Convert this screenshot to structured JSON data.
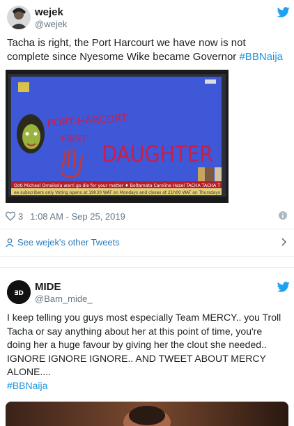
{
  "tweet1": {
    "display_name": "wejek",
    "handle": "@wejek",
    "text": "Tacha is right, the Port Harcourt we have now is not complete since Nyesome Wike became Governor ",
    "hashtag": "#BBNaija",
    "media": {
      "tv_title_line1": "PORT-HARCORT",
      "tv_title_line2": "FIRST",
      "tv_title_line3": "DAUGHTER",
      "ticker_line1": "Ooti Michael Omaikola warri go die for your matter  ♦ Boltamata Caroline Hazel TACHA TACHA T",
      "ticker_line2": "ee subscribers only  Voting opens at 19h30 WAT on Mondays and closes at 21h00 WAT on Thursdays"
    },
    "like_count": "3",
    "timestamp": "1:08 AM - Sep 25, 2019",
    "see_more_label": "See wejek's other Tweets"
  },
  "tweet2": {
    "display_name": "MIDE",
    "handle": "@Bam_mide_",
    "text": "I keep telling you guys most especially Team MERCY.. you Troll Tacha or say anything about her at this point of time, you're doing her a huge favour by giving her the clout she needed.. IGNORE IGNORE IGNORE.. AND TWEET ABOUT MERCY ALONE....",
    "hashtag": "#BBNaija"
  },
  "colors": {
    "twitter_blue": "#1da1f2",
    "link_blue": "#1b95e0",
    "muted_gray": "#657786",
    "divider": "#e6ecf0"
  },
  "icons": [
    "twitter-bird-icon",
    "heart-icon",
    "info-icon",
    "person-icon",
    "chevron-right-icon"
  ]
}
